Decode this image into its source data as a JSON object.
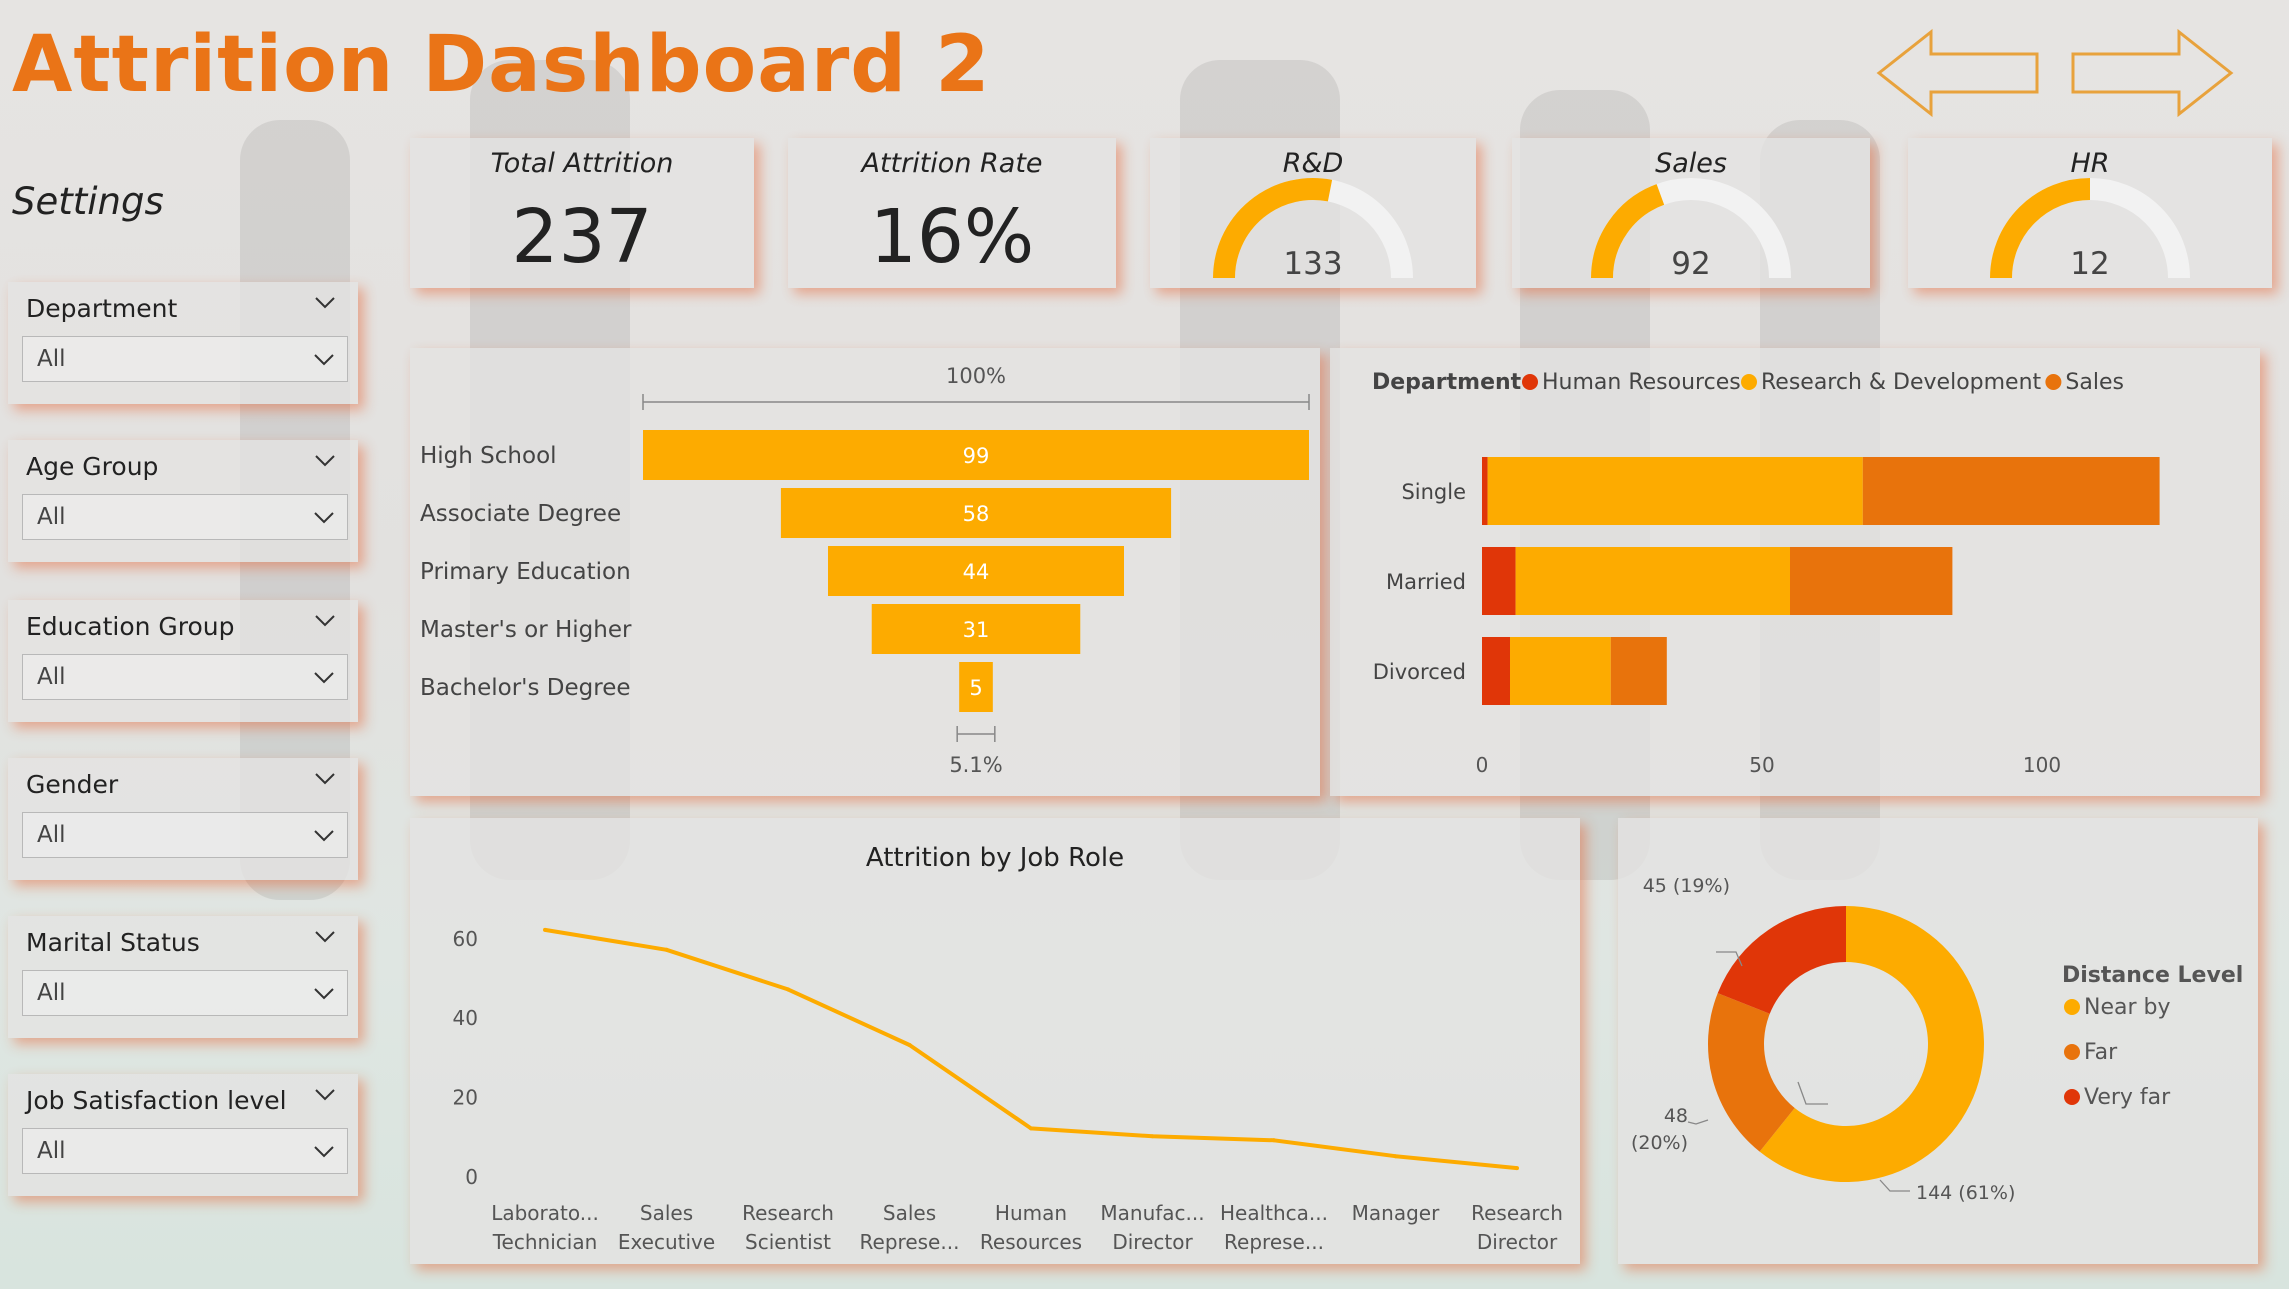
{
  "dashboard": {
    "title": "Attrition Dashboard 2"
  },
  "nav": {
    "back_icon": "arrow-left-icon",
    "forward_icon": "arrow-right-icon"
  },
  "settings": {
    "label": "Settings"
  },
  "slicers": [
    {
      "label": "Department",
      "value": "All"
    },
    {
      "label": "Age Group",
      "value": "All"
    },
    {
      "label": "Education Group",
      "value": "All"
    },
    {
      "label": "Gender",
      "value": "All"
    },
    {
      "label": "Marital Status",
      "value": "All"
    },
    {
      "label": "Job Satisfaction level",
      "value": "All"
    }
  ],
  "kpis": {
    "total_attrition": {
      "title": "Total Attrition",
      "value": "237"
    },
    "attrition_rate": {
      "title": "Attrition Rate",
      "value": "16%"
    }
  },
  "gauges": {
    "rd": {
      "title": "R&D",
      "value": 133,
      "max": 237
    },
    "sales": {
      "title": "Sales",
      "value": 92,
      "max": 237
    },
    "hr": {
      "title": "HR",
      "value": 12,
      "max": 24
    }
  },
  "colors": {
    "accent": "#ea7417",
    "yellow": "#fdab00",
    "orange": "#e8730c",
    "red": "#e03608",
    "shadow": "#e65a28"
  },
  "chart_data": [
    {
      "type": "funnel",
      "categories": [
        "High School",
        "Associate Degree",
        "Primary Education",
        "Master's or Higher",
        "Bachelor's Degree"
      ],
      "values": [
        99,
        58,
        44,
        31,
        5
      ],
      "top_label": "100%",
      "bottom_label": "5.1%"
    },
    {
      "type": "bar",
      "orientation": "horizontal",
      "stacked": true,
      "legend_title": "Department",
      "categories": [
        "Single",
        "Married",
        "Divorced"
      ],
      "series": [
        {
          "name": "Human Resources",
          "color": "#e03608",
          "values": [
            1,
            6,
            5
          ]
        },
        {
          "name": "Research & Development",
          "color": "#fdab00",
          "values": [
            67,
            49,
            18
          ]
        },
        {
          "name": "Sales",
          "color": "#e8730c",
          "values": [
            53,
            29,
            10
          ]
        }
      ],
      "xticks": [
        "0",
        "50",
        "100"
      ],
      "xlim": [
        0,
        120
      ],
      "legend_position": "top-left"
    },
    {
      "type": "line",
      "title": "Attrition by Job Role",
      "categories": [
        [
          "Laborato...",
          "Technician"
        ],
        [
          "Sales",
          "Executive"
        ],
        [
          "Research",
          "Scientist"
        ],
        [
          "Sales",
          "Represe..."
        ],
        [
          "Human",
          "Resources"
        ],
        [
          "Manufac...",
          "Director"
        ],
        [
          "Healthca...",
          "Represe..."
        ],
        [
          "Manager",
          ""
        ],
        [
          "Research",
          "Director"
        ]
      ],
      "values": [
        62,
        57,
        47,
        33,
        12,
        10,
        9,
        5,
        2
      ],
      "yticks": [
        "0",
        "20",
        "40",
        "60"
      ],
      "ylim": [
        0,
        65
      ],
      "color": "#fdab00"
    },
    {
      "type": "pie",
      "donut": true,
      "legend_title": "Distance Level",
      "slices": [
        {
          "name": "Near by",
          "value": 144,
          "label": "144 (61%)",
          "color": "#fdab00"
        },
        {
          "name": "Far",
          "value": 48,
          "label_line1": "48",
          "label_line2": "(20%)",
          "color": "#e8730c"
        },
        {
          "name": "Very far",
          "value": 45,
          "label": "45 (19%)",
          "color": "#e03608"
        }
      ],
      "legend_position": "right"
    }
  ]
}
